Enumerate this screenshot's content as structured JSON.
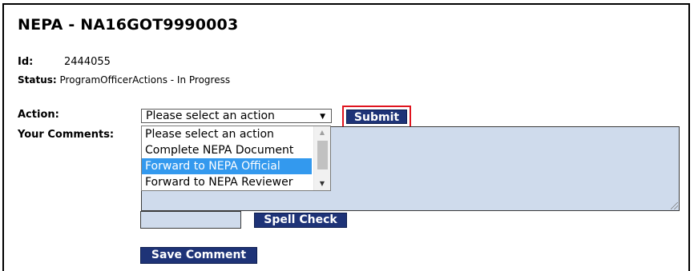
{
  "page": {
    "title": "NEPA - NA16GOT9990003",
    "id_label": "Id:",
    "id_value": "2444055",
    "status_label": "Status:",
    "status_value": "ProgramOfficerActions - In Progress"
  },
  "action": {
    "label": "Action:",
    "selected": "Please select an action",
    "options": [
      "Please select an action",
      "Complete NEPA Document",
      "Forward to NEPA Official",
      "Forward to NEPA Reviewer"
    ],
    "highlighted_index": 2,
    "submit_label": "Submit"
  },
  "comments": {
    "label": "Your Comments:",
    "value": ""
  },
  "buttons": {
    "spell_check": "Spell Check",
    "save_comment": "Save Comment"
  },
  "colors": {
    "button_bg": "#1e3377",
    "field_bg": "#cfdbec",
    "highlight": "#3399ee",
    "focus_outline": "#e0141e"
  }
}
